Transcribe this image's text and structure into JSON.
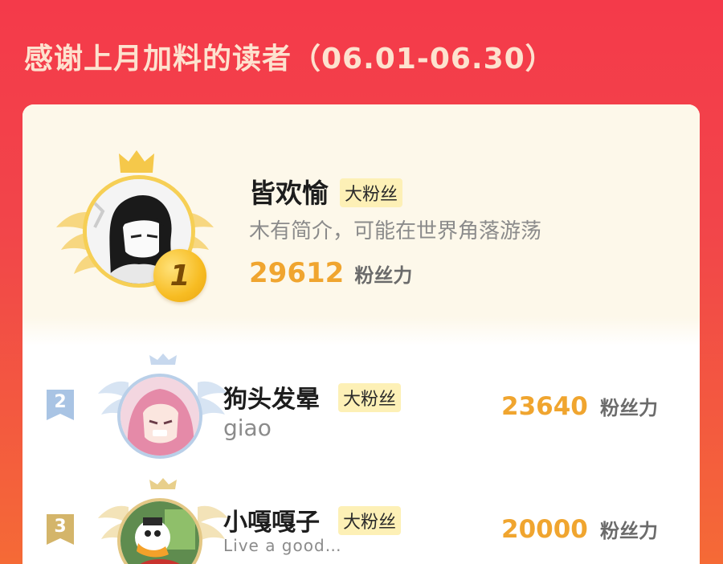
{
  "header": {
    "title": "感谢上月加料的读者（06.01-06.30）"
  },
  "top_reader": {
    "rank": "1",
    "name": "皆欢愉",
    "badge": "大粉丝",
    "bio": "木有简介，可能在世界角落游荡",
    "score": "29612",
    "score_unit": "粉丝力"
  },
  "readers": [
    {
      "rank": "2",
      "name": "狗头发晕",
      "badge": "大粉丝",
      "bio": "giao",
      "score": "23640",
      "score_unit": "粉丝力"
    },
    {
      "rank": "3",
      "name": "小嘎嘎子",
      "badge": "大粉丝",
      "bio": "Live a good…",
      "score": "20000",
      "score_unit": "粉丝力"
    }
  ],
  "colors": {
    "background_top": "#f43a4a",
    "background_bottom": "#f56a36",
    "accent_gold": "#f0a52f",
    "badge_bg": "#fdf0b6",
    "silver": "#a9c4e4",
    "bronze": "#d4b56a"
  },
  "icons": {
    "gold_crown": "crown-icon",
    "silver_wings": "wings-icon",
    "rank_medal": "medal-icon"
  }
}
